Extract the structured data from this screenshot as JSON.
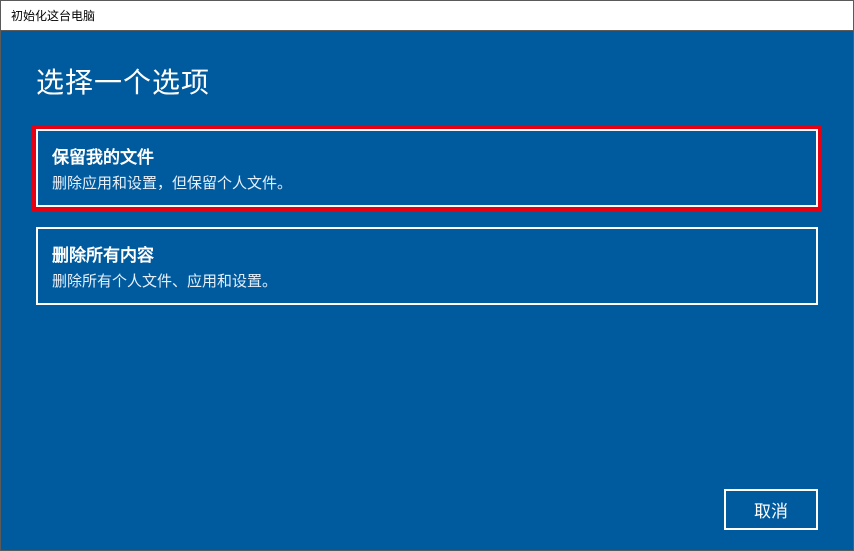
{
  "window": {
    "title": "初始化这台电脑"
  },
  "heading": "选择一个选项",
  "options": [
    {
      "title": "保留我的文件",
      "desc": "删除应用和设置，但保留个人文件。"
    },
    {
      "title": "删除所有内容",
      "desc": "删除所有个人文件、应用和设置。"
    }
  ],
  "footer": {
    "cancel": "取消"
  }
}
